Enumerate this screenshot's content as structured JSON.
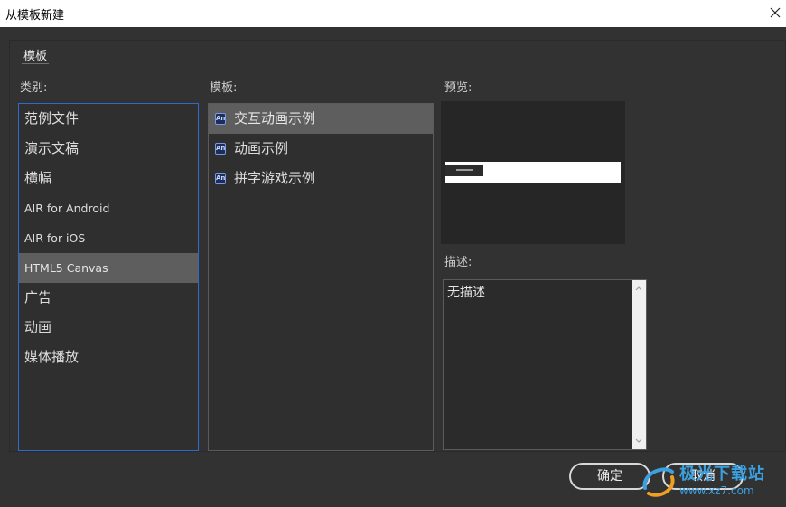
{
  "window": {
    "title": "从模板新建"
  },
  "tab": {
    "label": "模板"
  },
  "labels": {
    "category": "类别:",
    "template": "模板:",
    "preview": "预览:",
    "description": "描述:"
  },
  "categories": [
    {
      "label": "范例文件",
      "selected": false
    },
    {
      "label": "演示文稿",
      "selected": false
    },
    {
      "label": "横幅",
      "selected": false
    },
    {
      "label": "AIR for Android",
      "selected": false
    },
    {
      "label": "AIR for iOS",
      "selected": false
    },
    {
      "label": "HTML5 Canvas",
      "selected": true
    },
    {
      "label": "广告",
      "selected": false
    },
    {
      "label": "动画",
      "selected": false
    },
    {
      "label": "媒体播放",
      "selected": false
    }
  ],
  "templates": [
    {
      "label": "交互动画示例",
      "icon": "An",
      "selected": true
    },
    {
      "label": "动画示例",
      "icon": "An",
      "selected": false
    },
    {
      "label": "拼字游戏示例",
      "icon": "An",
      "selected": false
    }
  ],
  "description": {
    "text": "无描述"
  },
  "buttons": {
    "ok": "确定",
    "cancel": "取消"
  },
  "watermark": {
    "text": "极光下载站",
    "url": "www.xz7.com"
  },
  "colors": {
    "background": "#323232",
    "list_focus_border": "#2d6bd1",
    "selected_row": "#5e5e5e",
    "watermark": "#3aa0e0"
  }
}
